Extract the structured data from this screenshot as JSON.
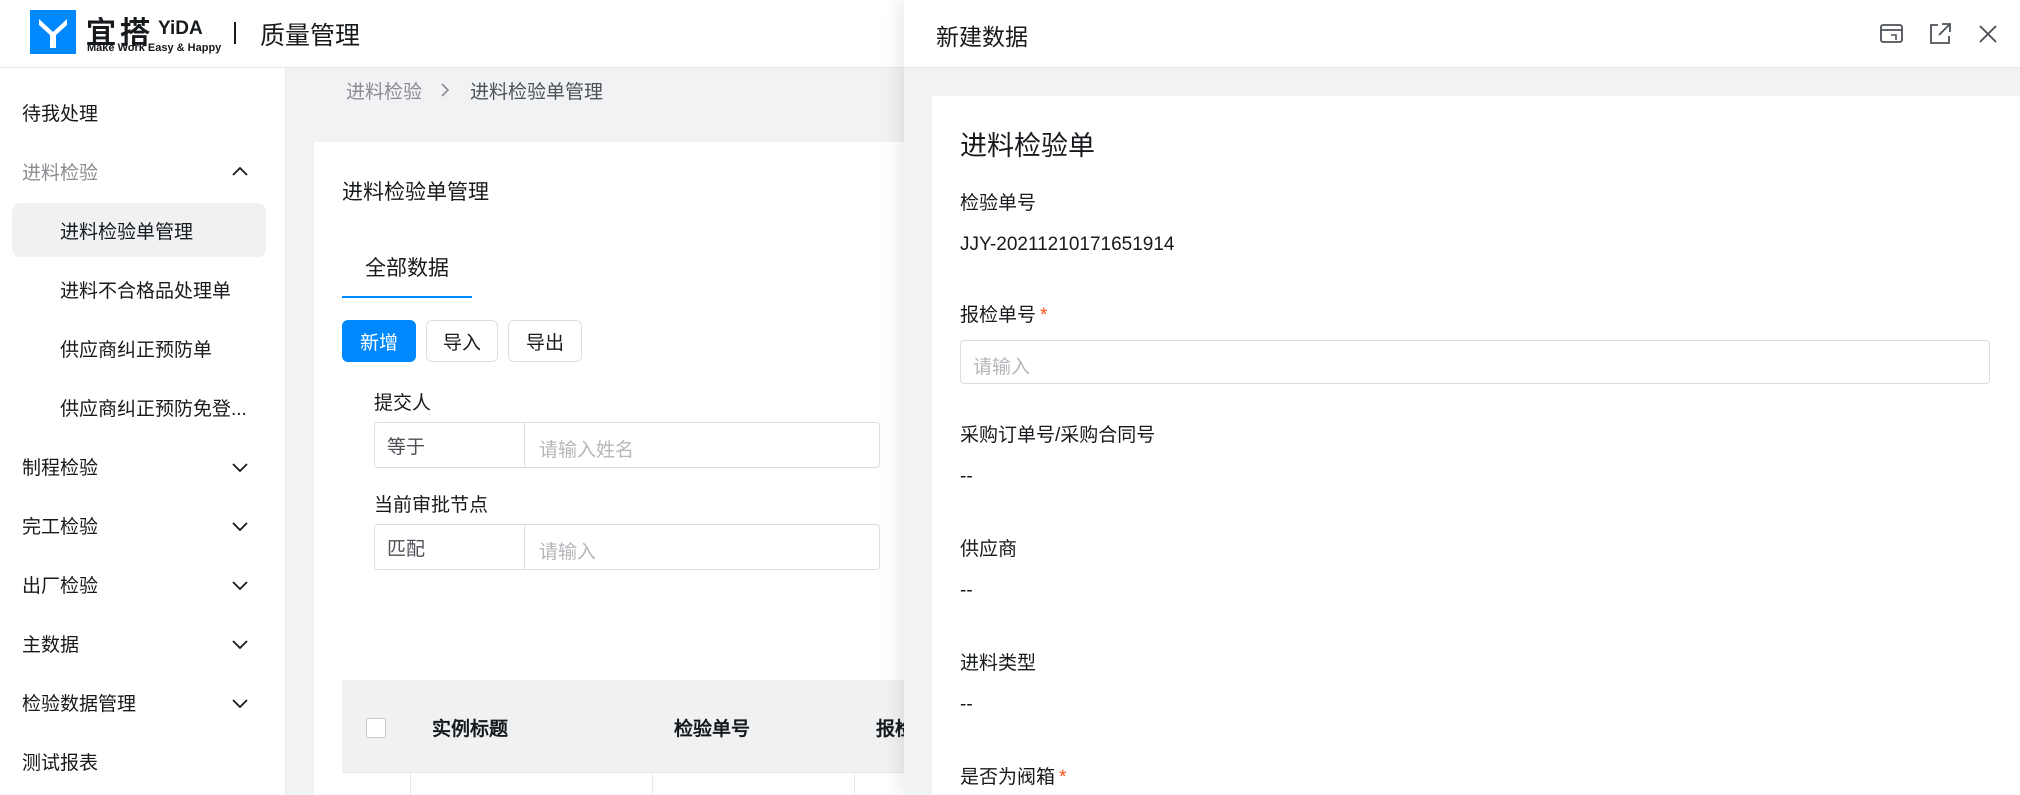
{
  "header": {
    "logo_cn": "宜搭",
    "logo_en": "YiDA",
    "logo_slogan": "Make Work Easy & Happy",
    "app_title": "质量管理"
  },
  "sidebar": {
    "items": [
      {
        "label": "待我处理"
      },
      {
        "label": "进料检验"
      },
      {
        "label": "进料检验单管理"
      },
      {
        "label": "进料不合格品处理单"
      },
      {
        "label": "供应商纠正预防单"
      },
      {
        "label": "供应商纠正预防免登..."
      },
      {
        "label": "制程检验"
      },
      {
        "label": "完工检验"
      },
      {
        "label": "出厂检验"
      },
      {
        "label": "主数据"
      },
      {
        "label": "检验数据管理"
      },
      {
        "label": "测试报表"
      }
    ]
  },
  "breadcrumb": {
    "parent": "进料检验",
    "current": "进料检验单管理"
  },
  "main": {
    "title": "进料检验单管理",
    "tab": "全部数据",
    "buttons": {
      "add": "新增",
      "import": "导入",
      "export": "导出"
    },
    "filters": [
      {
        "label": "提交人",
        "operator": "等于",
        "placeholder": "请输入姓名"
      },
      {
        "label": "当前审批节点",
        "operator": "匹配",
        "placeholder": "请输入"
      }
    ],
    "table": {
      "columns": [
        "实例标题",
        "检验单号",
        "报检"
      ]
    }
  },
  "drawer": {
    "title": "新建数据",
    "form_title": "进料检验单",
    "fields": [
      {
        "label": "检验单号",
        "value": "JJY-20211210171651914",
        "required": false
      },
      {
        "label": "报检单号",
        "placeholder": "请输入",
        "required": true
      },
      {
        "label": "采购订单号/采购合同号",
        "value": "--",
        "required": false
      },
      {
        "label": "供应商",
        "value": "--",
        "required": false
      },
      {
        "label": "进料类型",
        "value": "--",
        "required": false
      },
      {
        "label": "是否为阀箱",
        "required": true
      }
    ],
    "required_mark": "*"
  },
  "colors": {
    "primary": "#0089ff",
    "required": "#ff5219",
    "background": "#f1f2f3"
  },
  "icons": [
    "logo-icon",
    "chevron-up-icon",
    "chevron-down-icon",
    "chevron-right-icon",
    "window-icon",
    "open-external-icon",
    "close-icon"
  ]
}
